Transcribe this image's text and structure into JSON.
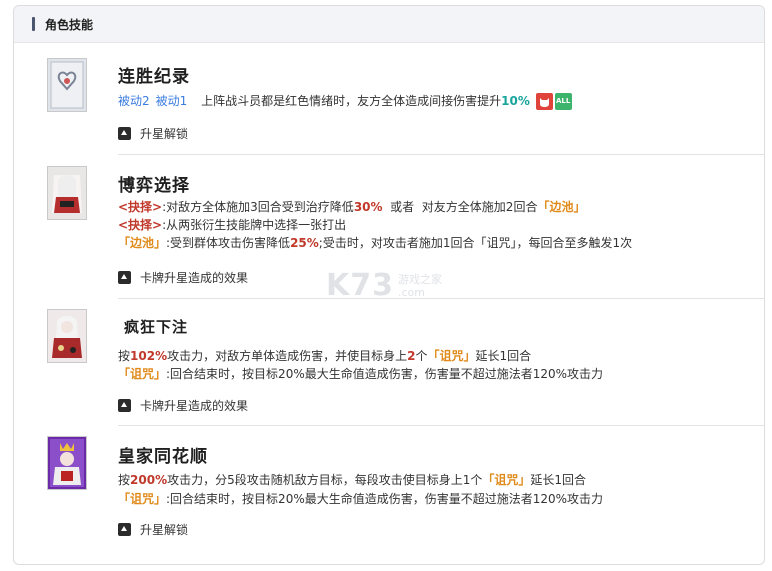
{
  "section": {
    "title": "角色技能"
  },
  "skills": [
    {
      "name": "连胜纪录",
      "tags": [
        "被动2",
        "被动1"
      ],
      "desc_pre": "上阵战斗员都是红色情绪时，友方全体造成间接伤害提升",
      "desc_value": "10%",
      "badge_all": "ALL",
      "expand": "升星解锁"
    },
    {
      "name": "博弈选择",
      "l1_k": "<抉择>",
      "l1_a": ":对敌方全体施加3回合受到治疗降低",
      "l1_v": "30%",
      "l1_b": "  或者  对友方全体施加2回合",
      "l1_s": "「边池」",
      "l2_k": "<抉择>",
      "l2_a": ":从两张衍生技能牌中选择一张打出",
      "l3_s": "「边池」",
      "l3_a": ":受到群体攻击伤害降低",
      "l3_v": "25%",
      "l3_b": ";受击时，对攻击者施加1回合「诅咒」，每回合至多触发1次",
      "expand": "卡牌升星造成的效果"
    },
    {
      "name": "疯狂下注",
      "l1_a": "按",
      "l1_v": "102%",
      "l1_b": "攻击力，对敌方单体造成伤害，并使目标身上",
      "l1_n": "2",
      "l1_c": "个",
      "l1_s": "「诅咒」",
      "l1_d": "延长1回合",
      "l2_s": "「诅咒」",
      "l2_a": ":回合结束时，按目标20%最大生命值造成伤害，伤害量不超过施法者120%攻击力",
      "expand": "卡牌升星造成的效果"
    },
    {
      "name": "皇家同花顺",
      "l1_a": "按",
      "l1_v": "200%",
      "l1_b": "攻击力，分5段攻击随机敌方目标，每段攻击使目标身上1个",
      "l1_s": "「诅咒」",
      "l1_d": "延长1回合",
      "l2_s": "「诅咒」",
      "l2_a": ":回合结束时，按目标20%最大生命值造成伤害，伤害量不超过施法者120%攻击力",
      "expand": "升星解锁"
    }
  ],
  "watermark": {
    "logo": "K73",
    "text1": "游戏之家",
    "text2": ".com"
  },
  "colors": {
    "accent_blue": "#3b7de0",
    "red": "#c0392b",
    "teal": "#1aa59c",
    "orange": "#e08a1a"
  },
  "icons": [
    "expand-up-icon",
    "red-cat-badge-icon",
    "all-target-badge-icon"
  ]
}
